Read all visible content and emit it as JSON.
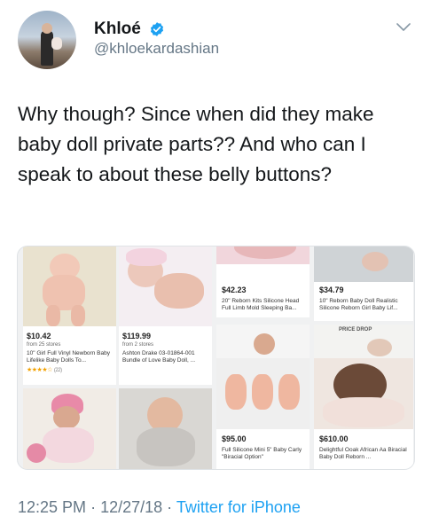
{
  "user": {
    "name": "Khloé",
    "handle": "@khloekardashian",
    "verified": true
  },
  "tweet": {
    "text": "Why though? Since when did they make baby doll private parts?? And who can I speak to about these belly buttons?",
    "time": "12:25 PM",
    "separator": "·",
    "date": "12/27/18",
    "source": "Twitter for iPhone"
  },
  "colors": {
    "link": "#1da1f2",
    "secondary": "#657786",
    "text": "#14171a",
    "verified": "#1da1f2"
  },
  "icons": {
    "verified": "verified-badge-icon",
    "menu": "chevron-down-icon"
  },
  "products": [
    {
      "price": "$10.42",
      "sub": "from 25 stores",
      "title": "10\" Girl Full Vinyl Newborn Baby Lifelike Baby Dolls To...",
      "rating": "(22)",
      "stars": "★★★★☆"
    },
    {
      "price": "$119.99",
      "sub": "from 2 stores",
      "title": "Ashton Drake 03-01864-001 Bundle of Love Baby Doll, ..."
    },
    {
      "price": "$42.23",
      "title": "20\" Reborn Kits Silicone Head Full Limb Mold Sleeping Ba..."
    },
    {
      "price": "$34.79",
      "title": "10\" Reborn Baby Doll Realistic Silicone Reborn Girl Baby Lif..."
    },
    {
      "price": "$95.00",
      "title": "Full Silicone Mini 5\" Baby Carly \"Biracial Option\""
    },
    {
      "price": "$610.00",
      "title": "Delightful Ooak African Aa Biracial Baby Doll Reborn ..."
    }
  ],
  "price_drop_label": "PRICE DROP"
}
